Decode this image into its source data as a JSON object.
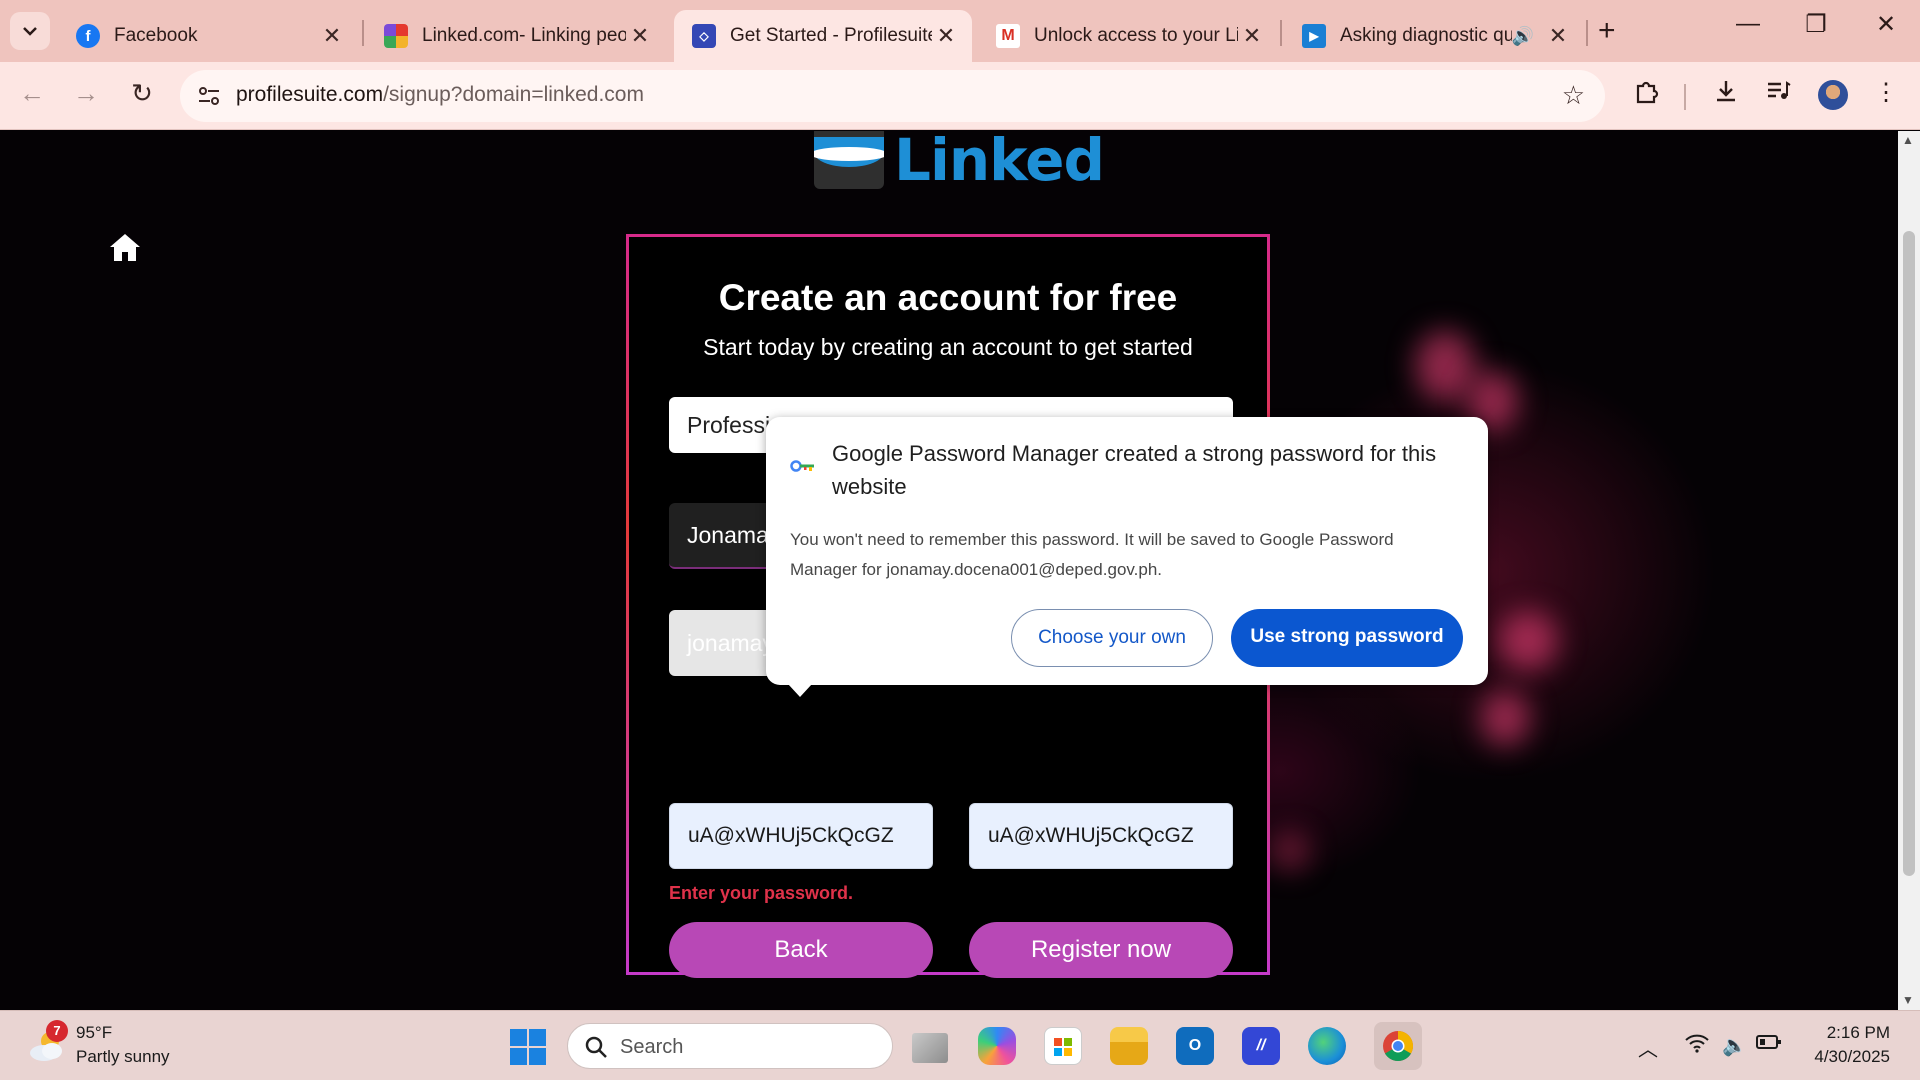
{
  "browser": {
    "tabs": [
      {
        "title": "Facebook",
        "favicon": "facebook-icon",
        "active": false
      },
      {
        "title": "Linked.com- Linking peo",
        "favicon": "linked-icon",
        "active": false
      },
      {
        "title": "Get Started - Profilesuite",
        "favicon": "profilesuite-icon",
        "active": true
      },
      {
        "title": "Unlock access to your Lin",
        "favicon": "gmail-icon",
        "active": false
      },
      {
        "title": "Asking diagnostic qu",
        "favicon": "video-icon",
        "active": false,
        "playing_audio": true
      }
    ],
    "url": {
      "host": "profilesuite.com",
      "path": "/signup?domain=linked.com"
    }
  },
  "page": {
    "logo_text": "Linked",
    "title": "Create an account for free",
    "subtitle": "Start today by creating an account to get started",
    "profession_value": "Professi",
    "name_value": "Jonama",
    "email_value": "jonamay",
    "password_value": "uA@xWHUj5CkQcGZ",
    "confirm_password_value": "uA@xWHUj5CkQcGZ",
    "password_error": "Enter your password.",
    "back_label": "Back",
    "register_label": "Register now"
  },
  "password_manager": {
    "title": "Google Password Manager created a strong password for this website",
    "body": "You won't need to remember this password. It will be saved to Google Password Manager for jonamay.docena001@deped.gov.ph.",
    "choose_label": "Choose your own",
    "use_label": "Use strong password"
  },
  "taskbar": {
    "weather_badge": "7",
    "temperature": "95°F",
    "weather_desc": "Partly sunny",
    "search_placeholder": "Search",
    "time": "2:16 PM",
    "date": "4/30/2025"
  },
  "colors": {
    "accent_button": "#b848b6",
    "error": "#e0324a",
    "pm_primary": "#0b57d0",
    "brand_blue": "#1e8fd6"
  }
}
